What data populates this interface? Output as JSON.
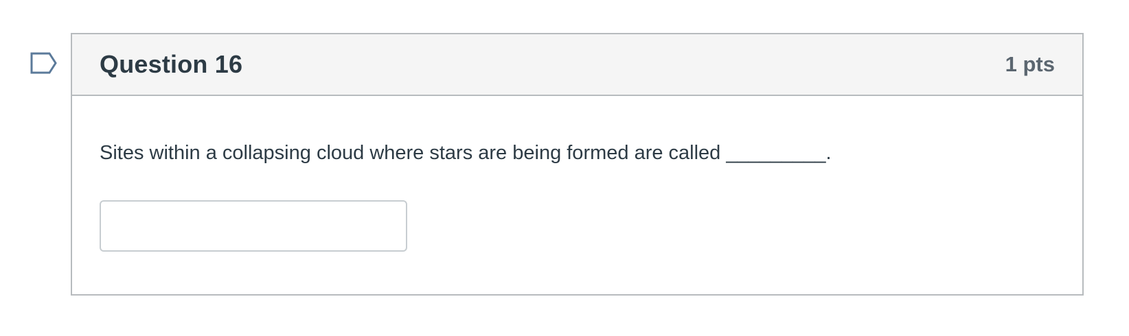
{
  "question": {
    "title": "Question 16",
    "points": "1 pts",
    "text": "Sites within a collapsing cloud where stars are being formed are called _________.",
    "answer_value": "",
    "answer_placeholder": ""
  },
  "flag": {
    "icon": "bookmark-flag-icon",
    "color": "#5b7a9a"
  },
  "colors": {
    "header_background": "#f5f5f5",
    "border": "#b7bbbe",
    "title_text": "#2d3b45",
    "points_text": "#5b6670"
  }
}
